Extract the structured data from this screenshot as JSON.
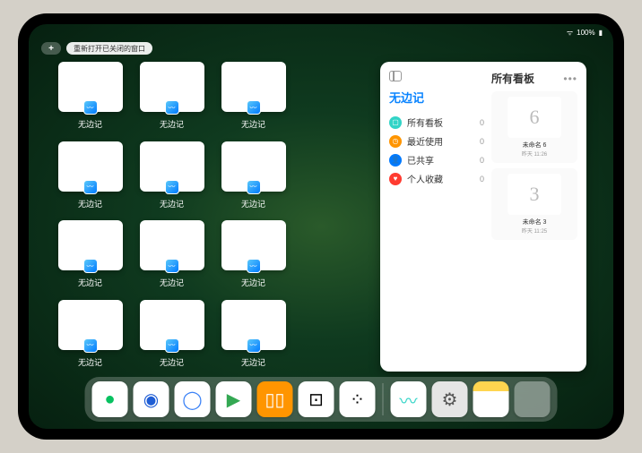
{
  "status": {
    "battery": "100%",
    "signal": "●●●"
  },
  "topbar": {
    "plus": "+",
    "reopen_label": "重新打开已关闭的窗口"
  },
  "thumbnails": {
    "label": "无边记",
    "items": [
      {
        "type": "blank"
      },
      {
        "type": "calendar"
      },
      {
        "type": "calendar"
      },
      null,
      {
        "type": "blank"
      },
      {
        "type": "calendar"
      },
      {
        "type": "calendar"
      },
      null,
      {
        "type": "blank"
      },
      {
        "type": "calendar"
      },
      {
        "type": "calendar"
      },
      null,
      {
        "type": "blank"
      },
      {
        "type": "blank"
      },
      {
        "type": "calendar"
      },
      null
    ]
  },
  "panel": {
    "title": "无边记",
    "sidebar": [
      {
        "icon": "cyan",
        "glyph": "▢",
        "label": "所有看板",
        "count": "0"
      },
      {
        "icon": "orange",
        "glyph": "◷",
        "label": "最近使用",
        "count": "0"
      },
      {
        "icon": "blue",
        "glyph": "👤",
        "label": "已共享",
        "count": "0"
      },
      {
        "icon": "red",
        "glyph": "♥",
        "label": "个人收藏",
        "count": "0"
      }
    ],
    "right_title": "所有看板",
    "boards": [
      {
        "sketch": "6",
        "name": "未命名 6",
        "date": "昨天 11:26"
      },
      {
        "sketch": "3",
        "name": "未命名 3",
        "date": "昨天 11:25"
      }
    ]
  },
  "dock": [
    {
      "name": "wechat",
      "bg": "#fff",
      "glyph": "●",
      "color": "#07c160"
    },
    {
      "name": "browser1",
      "bg": "#fff",
      "glyph": "◉",
      "color": "#1e5dd4"
    },
    {
      "name": "browser2",
      "bg": "#fff",
      "glyph": "◯",
      "color": "#3b82f6"
    },
    {
      "name": "play",
      "bg": "#fff",
      "glyph": "▶",
      "color": "#34a853"
    },
    {
      "name": "books",
      "bg": "#ff9500",
      "glyph": "▯▯",
      "color": "#fff"
    },
    {
      "name": "dice",
      "bg": "#fff",
      "glyph": "⊡",
      "color": "#000"
    },
    {
      "name": "dots",
      "bg": "#fff",
      "glyph": "⁘",
      "color": "#000"
    },
    {
      "name": "freeform",
      "bg": "#fff",
      "glyph": "〰",
      "color": "#32d4c7"
    },
    {
      "name": "settings",
      "bg": "#e5e5e5",
      "glyph": "⚙",
      "color": "#555"
    },
    {
      "name": "notes",
      "bg": "linear-gradient(#ffd54f 28%,#fff 28%)",
      "glyph": "",
      "color": "#000"
    }
  ]
}
